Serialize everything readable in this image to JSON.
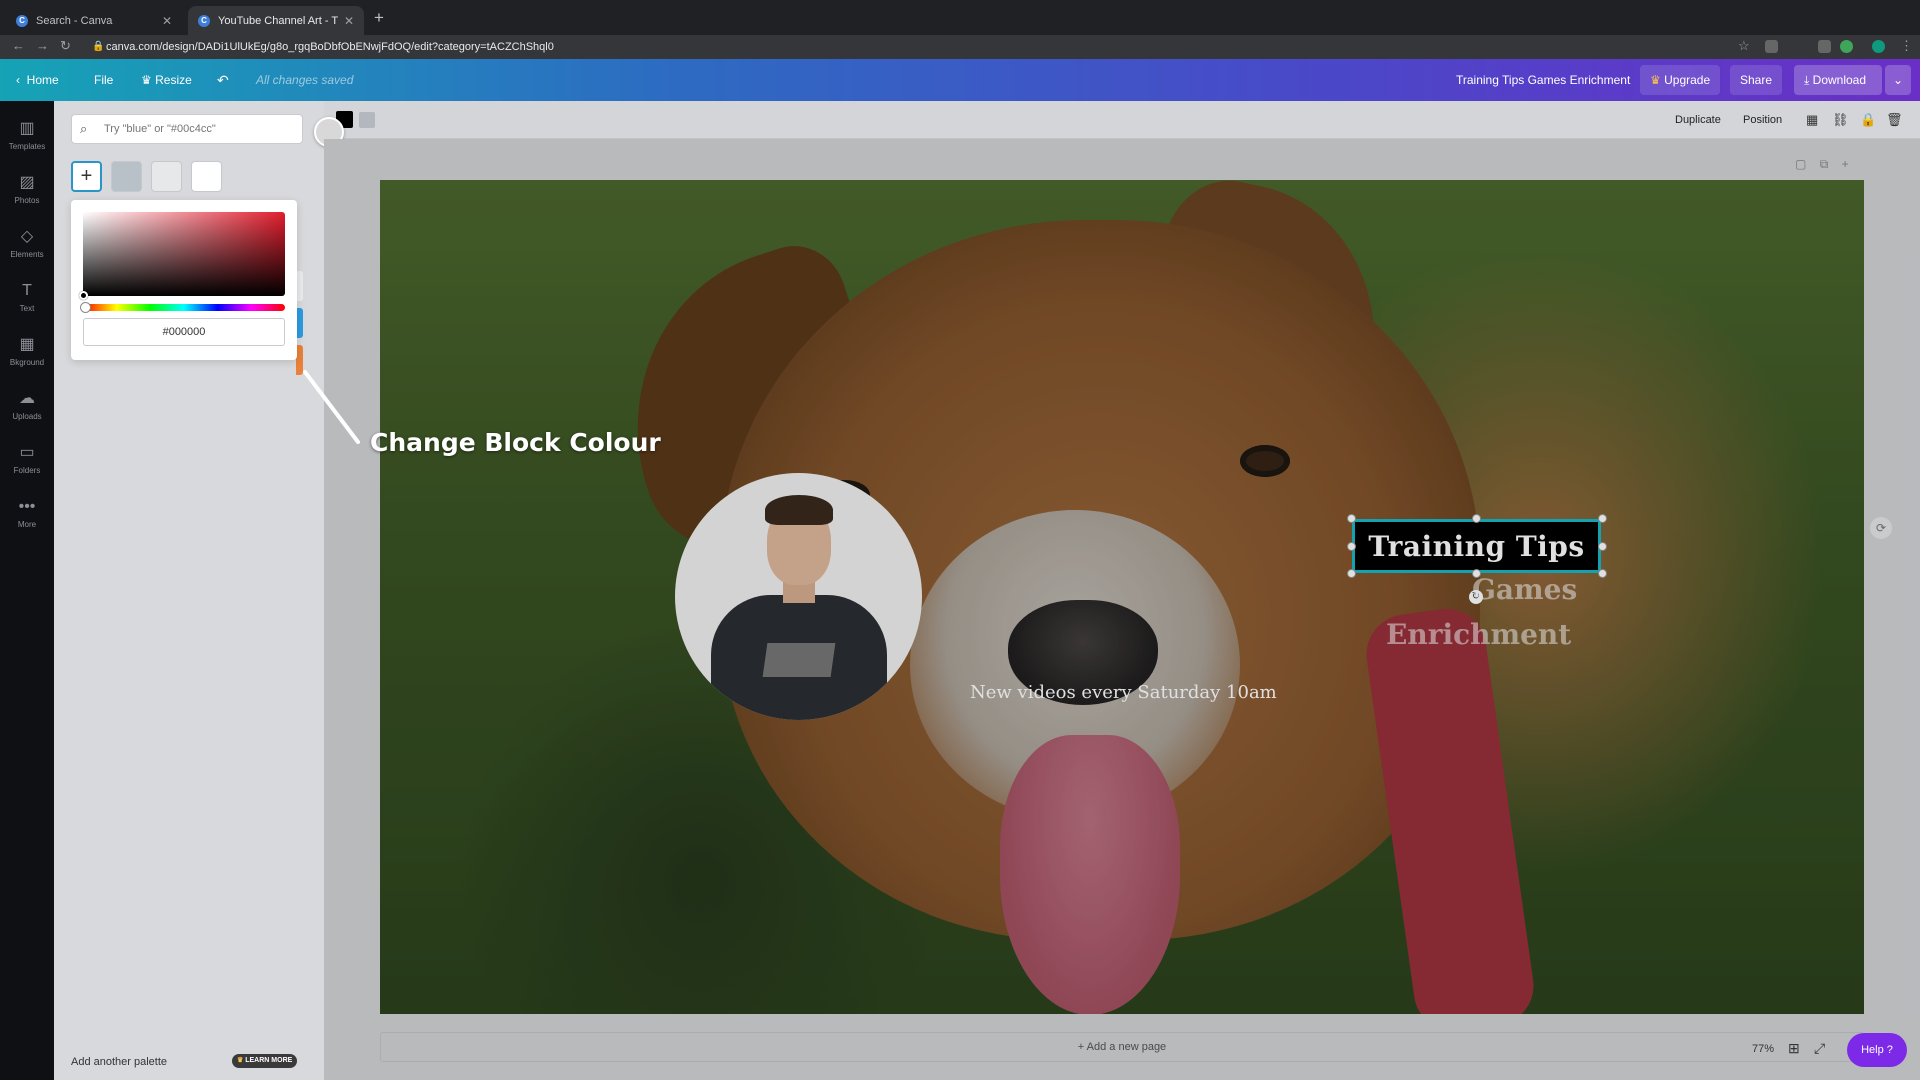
{
  "browser": {
    "tabs": [
      {
        "title": "Search - Canva",
        "icon": "canva-icon"
      },
      {
        "title": "YouTube Channel Art - Trainin",
        "icon": "canva-icon"
      }
    ],
    "url": "canva.com/design/DADi1UlUkEg/g8o_rgqBoDbfObENwjFdOQ/edit?category=tACZChShql0"
  },
  "header": {
    "home": "Home",
    "file": "File",
    "resize": "Resize",
    "saved_status": "All changes saved",
    "design_title": "Training Tips Games Enrichment",
    "upgrade": "Upgrade",
    "share": "Share",
    "download": "Download",
    "accent": "#7d2ae8"
  },
  "rail": [
    {
      "label": "Templates",
      "icon": "templates-icon"
    },
    {
      "label": "Photos",
      "icon": "photos-icon"
    },
    {
      "label": "Elements",
      "icon": "elements-icon"
    },
    {
      "label": "Text",
      "icon": "text-icon"
    },
    {
      "label": "Bkground",
      "icon": "background-icon"
    },
    {
      "label": "Uploads",
      "icon": "uploads-icon"
    },
    {
      "label": "Folders",
      "icon": "folders-icon"
    },
    {
      "label": "More",
      "icon": "more-icon"
    }
  ],
  "panel": {
    "search_placeholder": "Try \"blue\" or \"#00c4cc\"",
    "swatches": [
      "#b8c0c8",
      "#e6e8ea",
      "#ffffff"
    ],
    "hex_value": "#000000",
    "add_palette": "Add another palette",
    "learn_more": "LEARN MORE"
  },
  "toolbar": {
    "colours": [
      "#000000",
      "#b3b8be"
    ],
    "duplicate": "Duplicate",
    "position": "Position"
  },
  "design": {
    "title": "Training Tips",
    "line2": "Games",
    "line3": "Enrichment",
    "subtitle": "New videos every Saturday 10am",
    "title_bg": "#000000",
    "selection_color": "#17b8c9"
  },
  "canvas": {
    "add_page": "+ Add a new page"
  },
  "footer": {
    "zoom": "77%",
    "help": "Help ?"
  },
  "annotation": {
    "text": "Change Block Colour"
  }
}
